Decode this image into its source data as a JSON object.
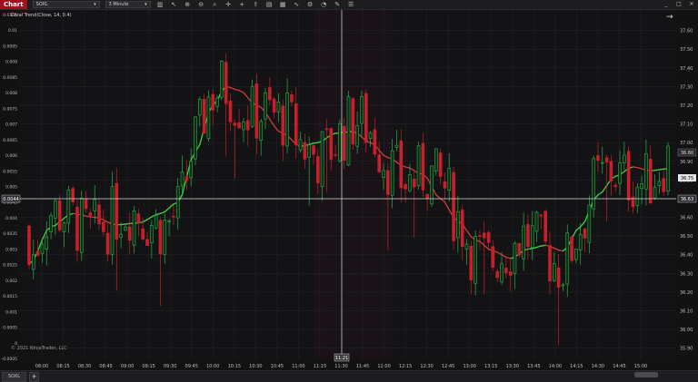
{
  "toolbar": {
    "badge": "Chart",
    "instrument": "SOXL",
    "interval": "3 Minute",
    "icons": [
      "bars-icon",
      "pointer-icon",
      "zoom-in-icon",
      "zoom-out-icon",
      "magnify-icon",
      "crosshair-icon",
      "plus-icon",
      "share-icon",
      "chart-type-icon",
      "data-box-icon",
      "indicators-icon",
      "strategies-icon",
      "alerts-icon",
      "drawing-tools-icon",
      "properties-icon",
      "window-minimize-icon",
      "window-maximize-icon",
      "window-close-icon"
    ]
  },
  "indicator_label": "Coral Trend(Close, 14, 0.4)",
  "watermark": "© 2021 NinjaTrader, LLC",
  "crosshair": {
    "time_label": "11:21",
    "left_value": "0.0044",
    "right_value": "36.63"
  },
  "current_price": "36.75",
  "mid_marker": "36.80",
  "tabs": [
    {
      "label": "SOXL"
    }
  ],
  "chart_data": {
    "type": "candlestick",
    "instrument": "SOXL",
    "interval": "3 Minute",
    "x_ticks": [
      "08:00",
      "08:15",
      "08:30",
      "08:45",
      "09:00",
      "09:15",
      "09:30",
      "09:45",
      "10:00",
      "10:15",
      "10:30",
      "10:45",
      "11:00",
      "11:15",
      "11:30",
      "11:45",
      "12:00",
      "12:15",
      "12:30",
      "12:45",
      "13:00",
      "13:15",
      "13:30",
      "13:45",
      "14:00",
      "14:15",
      "14:30",
      "14:45",
      "15:00"
    ],
    "right_axis_ticks": [
      "37.60",
      "37.50",
      "37.40",
      "37.30",
      "37.20",
      "37.10",
      "37.00",
      "36.90",
      "36.80",
      "36.70",
      "36.60",
      "36.50",
      "36.40",
      "36.30",
      "36.20",
      "36.10",
      "36.00",
      "35.90"
    ],
    "left_axis_ticks": [
      "0.0105",
      "0.01",
      "0.0095",
      "0.009",
      "0.0085",
      "0.008",
      "0.0075",
      "0.007",
      "0.0065",
      "0.006",
      "0.0055",
      "0.005",
      "0.0045",
      "0.004",
      "0.0035",
      "0.003",
      "0.0025",
      "0.002",
      "0.0015",
      "0.001",
      "0.0005",
      "0",
      "-0.0005"
    ],
    "right_axis_range": [
      35.84,
      37.71
    ],
    "colors": {
      "up": "#2bb24c",
      "down": "#c8202a",
      "trend_up": "#3fd43f",
      "trend_down": "#d23a3a",
      "background": "#121213",
      "grid": "#262629"
    },
    "trend_points": [
      [
        0,
        36.35
      ],
      [
        5,
        36.55
      ],
      [
        10,
        36.62
      ],
      [
        15,
        36.6
      ],
      [
        20,
        36.56
      ],
      [
        25,
        36.57
      ],
      [
        30,
        36.62
      ],
      [
        34,
        36.68
      ],
      [
        38,
        36.95
      ],
      [
        42,
        37.2
      ],
      [
        45,
        37.3
      ],
      [
        48,
        37.28
      ],
      [
        52,
        37.2
      ],
      [
        58,
        37.05
      ],
      [
        62,
        36.98
      ],
      [
        66,
        37.0
      ],
      [
        70,
        37.05
      ],
      [
        74,
        37.06
      ],
      [
        78,
        37.0
      ],
      [
        82,
        36.92
      ],
      [
        86,
        36.87
      ],
      [
        90,
        36.83
      ],
      [
        94,
        36.7
      ],
      [
        98,
        36.58
      ],
      [
        102,
        36.48
      ],
      [
        106,
        36.42
      ],
      [
        110,
        36.38
      ],
      [
        114,
        36.43
      ],
      [
        118,
        36.45
      ],
      [
        122,
        36.42
      ],
      [
        126,
        36.55
      ],
      [
        130,
        36.72
      ],
      [
        134,
        36.82
      ],
      [
        138,
        36.87
      ],
      [
        142,
        36.85
      ],
      [
        146,
        36.86
      ]
    ],
    "trend_break_index": 72,
    "candle_count": 147,
    "candle_noise_seed": 7
  }
}
